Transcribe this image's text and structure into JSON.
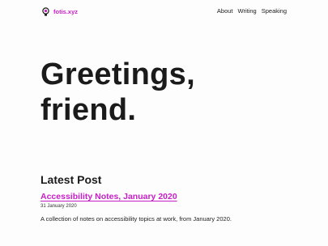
{
  "header": {
    "brand": "fotis.xyz",
    "brand_icon": "bulb-icon",
    "nav": {
      "about": "About",
      "writing": "Writing",
      "speaking": "Speaking"
    }
  },
  "hero": {
    "line1": "Greetings,",
    "line2": "friend."
  },
  "latest": {
    "title": "Latest Post",
    "post_title": "Accessibility Notes, January 2020",
    "post_date": "31 January 2020",
    "post_excerpt": "A collection of notes on accessibility topics at work, from January 2020."
  },
  "colors": {
    "accent": "#c81ec8",
    "text": "#1b1b1b",
    "background": "#fdfdfd"
  }
}
